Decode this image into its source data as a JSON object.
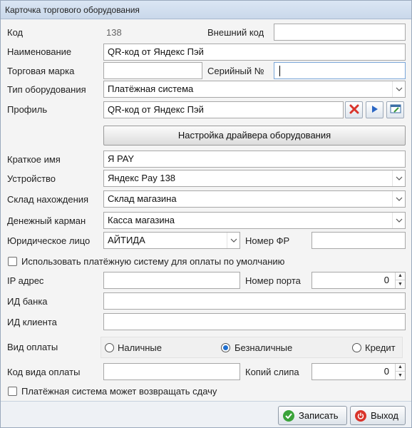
{
  "window": {
    "title": "Карточка торгового оборудования"
  },
  "labels": {
    "code": "Код",
    "external_code": "Внешний код",
    "name": "Наименование",
    "brand": "Торговая марка",
    "serial": "Серийный №",
    "type": "Тип оборудования",
    "profile": "Профиль",
    "short_name": "Краткое имя",
    "device": "Устройство",
    "warehouse": "Склад нахождения",
    "cash_drawer": "Денежный карман",
    "legal_entity": "Юридическое лицо",
    "fr_number": "Номер ФР",
    "ip": "IP адрес",
    "port": "Номер порта",
    "bank_id": "ИД банка",
    "client_id": "ИД клиента",
    "payment_type": "Вид оплаты",
    "payment_code": "Код вида оплаты",
    "slip_copies": "Копий слипа"
  },
  "values": {
    "code": "138",
    "external_code": "",
    "name": "QR-код от Яндекс Пэй",
    "brand": "",
    "serial": "",
    "type": "Платёжная система",
    "profile": "QR-код от Яндекс Пэй",
    "short_name": "Я PAY",
    "device": "Яндекс Pay 138",
    "warehouse": "Склад магазина",
    "cash_drawer": "Касса магазина",
    "legal_entity": "АЙТИДА",
    "fr_number": "",
    "ip": "",
    "port": "0",
    "bank_id": "",
    "client_id": "",
    "payment_code": "",
    "slip_copies": "0"
  },
  "buttons": {
    "driver_settings": "Настройка драйвера оборудования",
    "save": "Записать",
    "exit": "Выход"
  },
  "checkboxes": {
    "default_payment": {
      "label": "Использовать платёжную систему для оплаты по умолчанию",
      "checked": false
    },
    "can_return_change": {
      "label": "Платёжная система может возвращать сдачу",
      "checked": false
    }
  },
  "payment_options": [
    {
      "label": "Наличные",
      "selected": false
    },
    {
      "label": "Безналичные",
      "selected": true
    },
    {
      "label": "Кредит",
      "selected": false
    }
  ],
  "colors": {
    "accent": "#1e6fd0",
    "delete_icon": "#d9342b",
    "save_icon": "#3aa33a",
    "exit_icon": "#d9342b"
  },
  "icons": {
    "profile_clear": "delete-x-icon",
    "profile_open": "play-arrow-icon",
    "profile_edit": "edit-window-icon",
    "save": "check-circle-icon",
    "exit": "power-icon"
  }
}
